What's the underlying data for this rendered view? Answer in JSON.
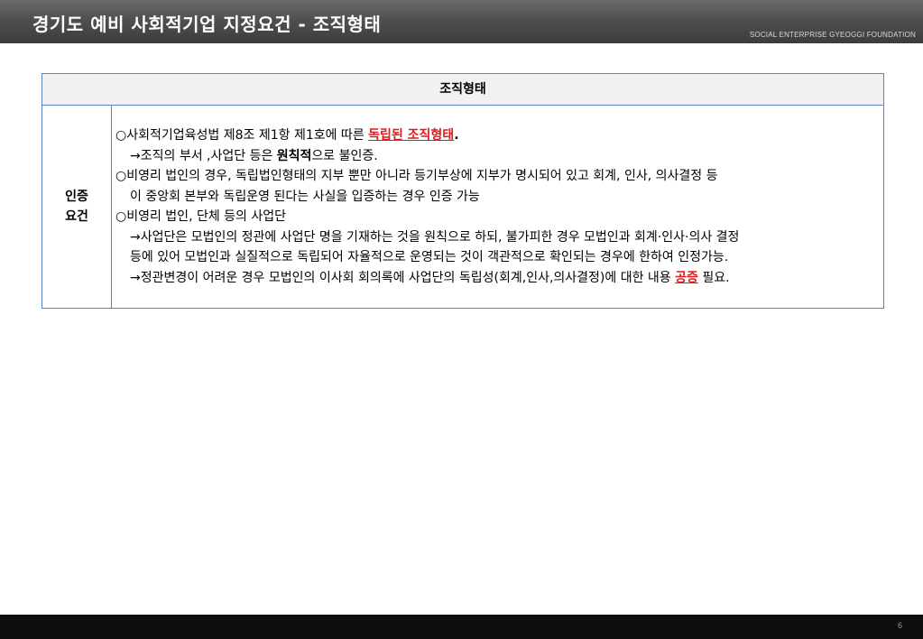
{
  "header": {
    "title": "경기도 예비 사회적기업 지정요건 - 조직형태",
    "subtitle": "SOCIAL ENTERPRISE GYEOGGI FOUNDATION"
  },
  "table": {
    "header": "조직형태",
    "label_line1": "인증",
    "label_line2": "요건",
    "lines": {
      "l1_a": "○사회적기업육성법 제8조 제1항 제1호에 따른 ",
      "l1_red": "독립된 조직형태",
      "l1_b": ".",
      "l2_a": "→조직의 부서 ,사업단 등은 ",
      "l2_bold": "원칙적",
      "l2_b": "으로 불인증.",
      "l3": "○비영리 법인의 경우, 독립법인형태의 지부 뿐만 아니라 등기부상에 지부가 명시되어 있고 회계, 인사, 의사결정 등",
      "l4": "이 중앙회 본부와 독립운영 된다는 사실을 입증하는 경우 인증 가능",
      "l5": "○비영리 법인, 단체 등의 사업단",
      "l6": "→사업단은 모법인의 정관에 사업단 명을 기재하는 것을 원칙으로 하되, 불가피한 경우 모법인과 회계·인사·의사 결정",
      "l7": "등에 있어 모법인과 실질적으로 독립되어 자율적으로 운영되는 것이 객관적으로 확인되는 경우에 한하여 인정가능.",
      "l8_a": "→정관변경이 어려운 경우 모법인의 이사회 회의록에 사업단의 독립성(회계,인사,의사결정)에 대한 내용 ",
      "l8_red": "공증",
      "l8_b": " 필요."
    }
  },
  "footer": {
    "page_number": "6"
  },
  "colors": {
    "table_border": "#5a83c5",
    "highlight_red": "#e01b1b",
    "header_bg": "#505050",
    "footer_bg": "#0e0e0e"
  }
}
